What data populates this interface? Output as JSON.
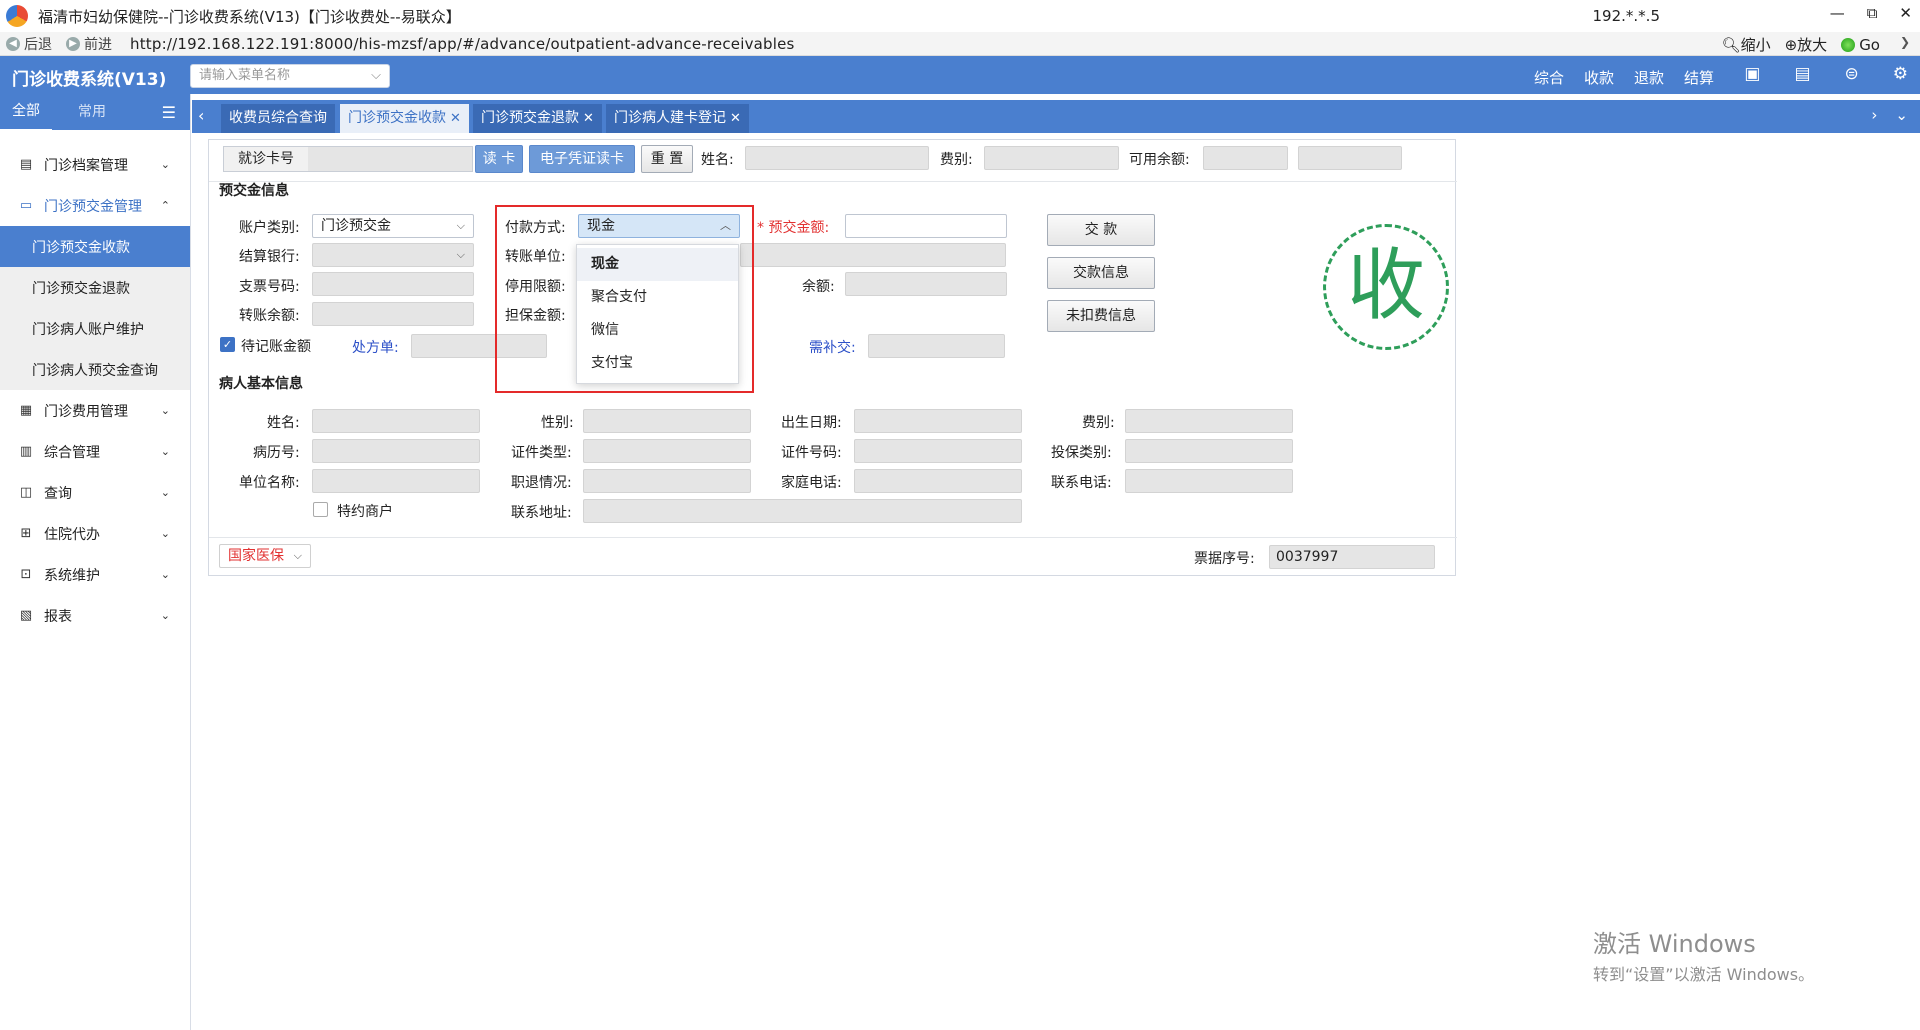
{
  "window": {
    "title": "福清市妇幼保健院--门诊收费系统(V13)【门诊收费处--易联众】",
    "ip": "192.*.*.5",
    "buttons": [
      "—",
      "⧉",
      "✕"
    ]
  },
  "addressbar": {
    "back": "后退",
    "forward": "前进",
    "url": "http://192.168.122.191:8000/his-mzsf/app/#/advance/outpatient-advance-receivables",
    "zoom_out": "缩小",
    "zoom_in": "放大",
    "go": "Go"
  },
  "header": {
    "app_title": "门诊收费系统(V13)",
    "menu_search_placeholder": "请输入菜单名称",
    "links": [
      "综合",
      "收款",
      "退款",
      "结算"
    ],
    "icons": [
      "monitor-icon",
      "document-icon",
      "coin-icon",
      "gear-icon"
    ]
  },
  "sidebar": {
    "tab_all": "全部",
    "tab_common": "常用",
    "items": [
      {
        "label": "门诊档案管理",
        "icon": "archive-icon"
      },
      {
        "label": "门诊预交金管理",
        "icon": "wallet-icon"
      },
      {
        "label": "门诊费用管理",
        "icon": "fee-icon"
      },
      {
        "label": "综合管理",
        "icon": "manage-icon"
      },
      {
        "label": "查询",
        "icon": "query-icon"
      },
      {
        "label": "住院代办",
        "icon": "hospital-icon"
      },
      {
        "label": "系统维护",
        "icon": "system-icon"
      },
      {
        "label": "报表",
        "icon": "report-icon"
      }
    ],
    "subitems": [
      "门诊预交金收款",
      "门诊预交金退款",
      "门诊病人账户维护",
      "门诊病人预交金查询"
    ]
  },
  "tabs": [
    {
      "label": "收费员综合查询"
    },
    {
      "label": "门诊预交金收款"
    },
    {
      "label": "门诊预交金退款"
    },
    {
      "label": "门诊病人建卡登记"
    }
  ],
  "form": {
    "card_label": "就诊卡号",
    "btn_read_card": "读 卡",
    "btn_e_voucher": "电子凭证读卡",
    "btn_reset": "重 置",
    "name_label": "姓名:",
    "fee_type_label": "费别:",
    "available_balance_label": "可用余额:",
    "advance_section": "预交金信息",
    "account_type_label": "账户类别:",
    "account_type_value": "门诊预交金",
    "settle_bank_label": "结算银行:",
    "cheque_no_label": "支票号码:",
    "transfer_balance_label": "转账余额:",
    "pending_amount_label": "待记账金额",
    "prescription_label": "处方单:",
    "pay_method_label": "付款方式:",
    "pay_method_value": "现金",
    "transfer_unit_label": "转账单位:",
    "stop_limit_label": "停用限额:",
    "guarantee_amount_label": "担保金额:",
    "advance_amount_label": "预交金额:",
    "required_mark": "*",
    "balance_label": "余额:",
    "need_pay_label": "需补交:",
    "btn_pay": "交 款",
    "btn_pay_info": "交款信息",
    "btn_undeducted": "未扣费信息",
    "stamp": "收",
    "patient_section": "病人基本信息",
    "p_name": "姓名:",
    "p_gender": "性别:",
    "p_birth": "出生日期:",
    "p_fee_type": "费别:",
    "p_record_no": "病历号:",
    "p_id_type": "证件类型:",
    "p_id_no": "证件号码:",
    "p_insurance_type": "投保类别:",
    "p_company": "单位名称:",
    "p_job_status": "职退情况:",
    "p_home_phone": "家庭电话:",
    "p_contact_phone": "联系电话:",
    "p_special_merchant": "特约商户",
    "p_address": "联系地址:",
    "insurance_select": "国家医保",
    "receipt_no_label": "票据序号:",
    "receipt_no_value": "0037997"
  },
  "dropdown_options": [
    "现金",
    "聚合支付",
    "微信",
    "支付宝"
  ],
  "watermark": {
    "line1": "激活 Windows",
    "line2": "转到“设置”以激活 Windows。"
  }
}
